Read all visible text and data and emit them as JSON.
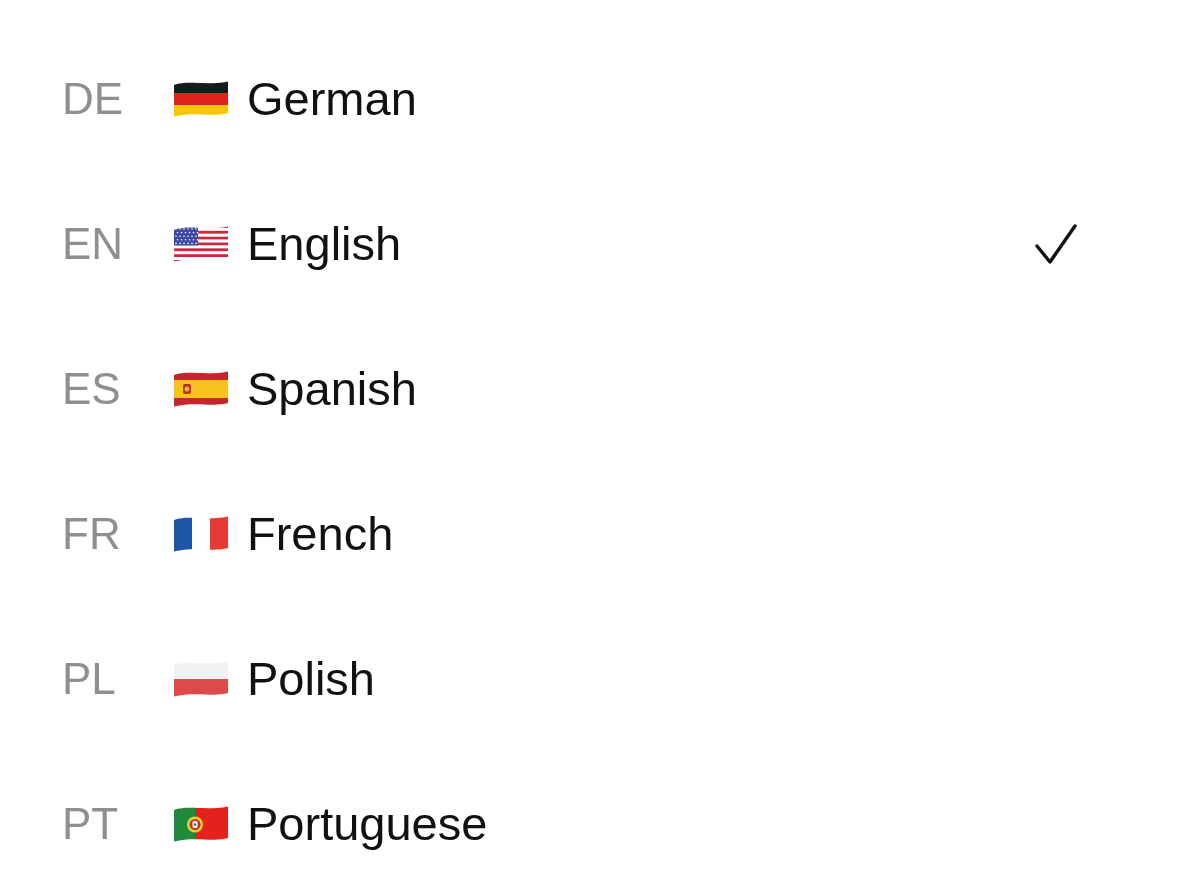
{
  "languages": [
    {
      "code": "DE",
      "name": "German",
      "kind": "de",
      "selected": false
    },
    {
      "code": "EN",
      "name": "English",
      "kind": "us",
      "selected": true
    },
    {
      "code": "ES",
      "name": "Spanish",
      "kind": "es",
      "selected": false
    },
    {
      "code": "FR",
      "name": "French",
      "kind": "fr",
      "selected": false
    },
    {
      "code": "PL",
      "name": "Polish",
      "kind": "pl",
      "selected": false
    },
    {
      "code": "PT",
      "name": "Portuguese",
      "kind": "pt",
      "selected": false
    }
  ]
}
